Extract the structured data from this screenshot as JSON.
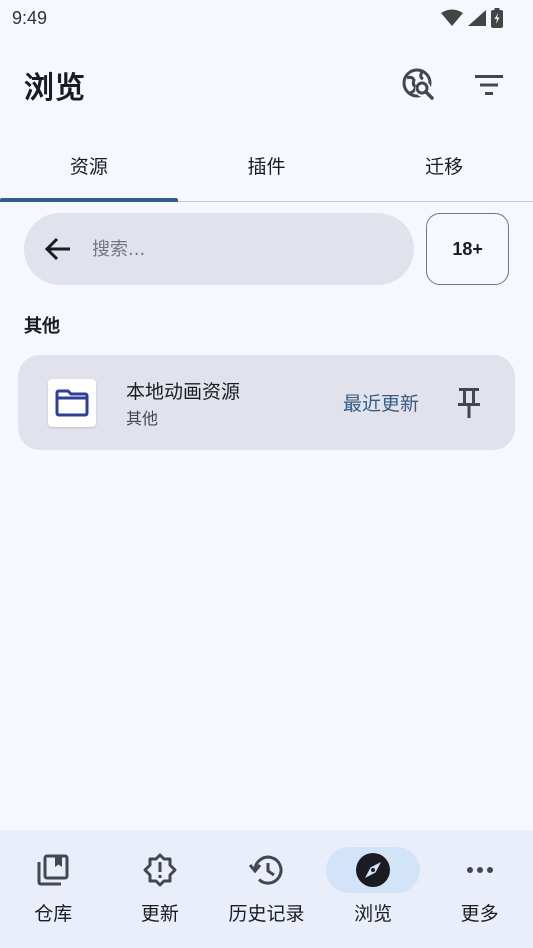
{
  "status": {
    "time": "9:49"
  },
  "app_bar": {
    "title": "浏览"
  },
  "tabs": [
    {
      "label": "资源",
      "active": true
    },
    {
      "label": "插件",
      "active": false
    },
    {
      "label": "迁移",
      "active": false
    }
  ],
  "search": {
    "placeholder": "搜索...",
    "nsfw_label": "18+"
  },
  "section": {
    "title": "其他"
  },
  "source": {
    "name": "本地动画资源",
    "language": "其他",
    "latest_label": "最近更新"
  },
  "bottom_nav": [
    {
      "label": "仓库",
      "icon": "library-icon"
    },
    {
      "label": "更新",
      "icon": "updates-icon"
    },
    {
      "label": "历史记录",
      "icon": "history-icon"
    },
    {
      "label": "浏览",
      "icon": "explore-icon",
      "active": true
    },
    {
      "label": "更多",
      "icon": "more-icon"
    }
  ],
  "colors": {
    "accent": "#355d86",
    "surface": "#f6f8ff",
    "card": "#e1e2eb",
    "nav_bg": "#e9eefa",
    "nav_active": "#d3e4f8"
  }
}
